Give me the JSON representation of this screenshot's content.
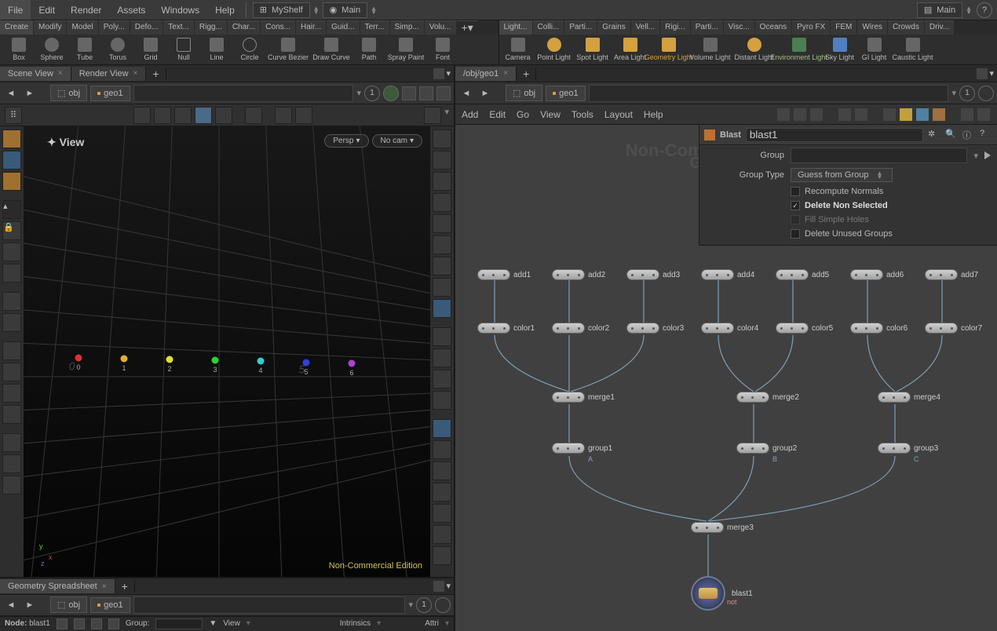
{
  "menu": {
    "file": "File",
    "edit": "Edit",
    "render": "Render",
    "assets": "Assets",
    "windows": "Windows",
    "help": "Help"
  },
  "shelves": {
    "myshelf": "MyShelf",
    "main": "Main",
    "main2": "Main"
  },
  "leftShelfTabs": [
    "Create",
    "Modify",
    "Model",
    "Poly...",
    "Defo...",
    "Text...",
    "Rigg...",
    "Char...",
    "Cons...",
    "Hair...",
    "Guid...",
    "Terr...",
    "Simp...",
    "Volu..."
  ],
  "leftTools": [
    "Box",
    "Sphere",
    "Tube",
    "Torus",
    "Grid",
    "Null",
    "Line",
    "Circle",
    "Curve Bezier",
    "Draw Curve",
    "Path",
    "Spray Paint",
    "Font"
  ],
  "rightShelfTabs": [
    "Light...",
    "Colli...",
    "Parti...",
    "Grains",
    "Vell...",
    "Rigi...",
    "Parti...",
    "Visc...",
    "Oceans",
    "Pyro FX",
    "FEM",
    "Wires",
    "Crowds",
    "Driv..."
  ],
  "rightTools": [
    "Camera",
    "Point Light",
    "Spot Light",
    "Area Light",
    "Geometry Light",
    "Volume Light",
    "Distant Light",
    "Environment Light",
    "Sky Light",
    "GI Light",
    "Caustic Light"
  ],
  "leftPane": {
    "tabs": {
      "sceneView": "Scene View",
      "renderView": "Render View"
    },
    "path": {
      "obj": "obj",
      "geo": "geo1",
      "index": "1"
    },
    "viewport": {
      "title": "View",
      "persp": "Persp",
      "nocam": "No cam",
      "nce": "Non-Commercial Edition",
      "scaleNums": [
        "0",
        "5"
      ],
      "points": [
        {
          "idx": "0",
          "color": "#e03030"
        },
        {
          "idx": "1",
          "color": "#e0b030"
        },
        {
          "idx": "2",
          "color": "#e0e030"
        },
        {
          "idx": "3",
          "color": "#30d030"
        },
        {
          "idx": "4",
          "color": "#30d0d0"
        },
        {
          "idx": "5",
          "color": "#3040e0"
        },
        {
          "idx": "6",
          "color": "#b040d0"
        }
      ]
    },
    "spreadsheet": {
      "title": "Geometry Spreadsheet",
      "node": "Node:",
      "nodeVal": "blast1",
      "group": "Group:",
      "view": "View",
      "intrinsics": "Intrinsics",
      "attri": "Attri"
    }
  },
  "rightPane": {
    "tab": "/obj/geo1",
    "path": {
      "obj": "obj",
      "geo": "geo1",
      "index": "1"
    },
    "netMenu": {
      "add": "Add",
      "edit": "Edit",
      "go": "Go",
      "view": "View",
      "tools": "Tools",
      "layout": "Layout",
      "help": "Help"
    },
    "watermark": "Non-Commercial Edition",
    "watermark2": "Geometry",
    "params": {
      "type": "Blast",
      "name": "blast1",
      "group": "Group",
      "groupType": "Group Type",
      "guess": "Guess from Group",
      "recompute": "Recompute Normals",
      "deleteNon": "Delete Non Selected",
      "fill": "Fill Simple Holes",
      "deleteUnused": "Delete Unused Groups"
    },
    "nodes": {
      "add": [
        "add1",
        "add2",
        "add3",
        "add4",
        "add5",
        "add6",
        "add7"
      ],
      "color": [
        "color1",
        "color2",
        "color3",
        "color4",
        "color5",
        "color6",
        "color7"
      ],
      "merge": [
        "merge1",
        "merge2",
        "merge4",
        "merge3"
      ],
      "group": [
        "group1",
        "group2",
        "group3"
      ],
      "groupLabel": [
        "A",
        "B",
        "C"
      ],
      "blast": "blast1",
      "blastOut": "not"
    }
  }
}
